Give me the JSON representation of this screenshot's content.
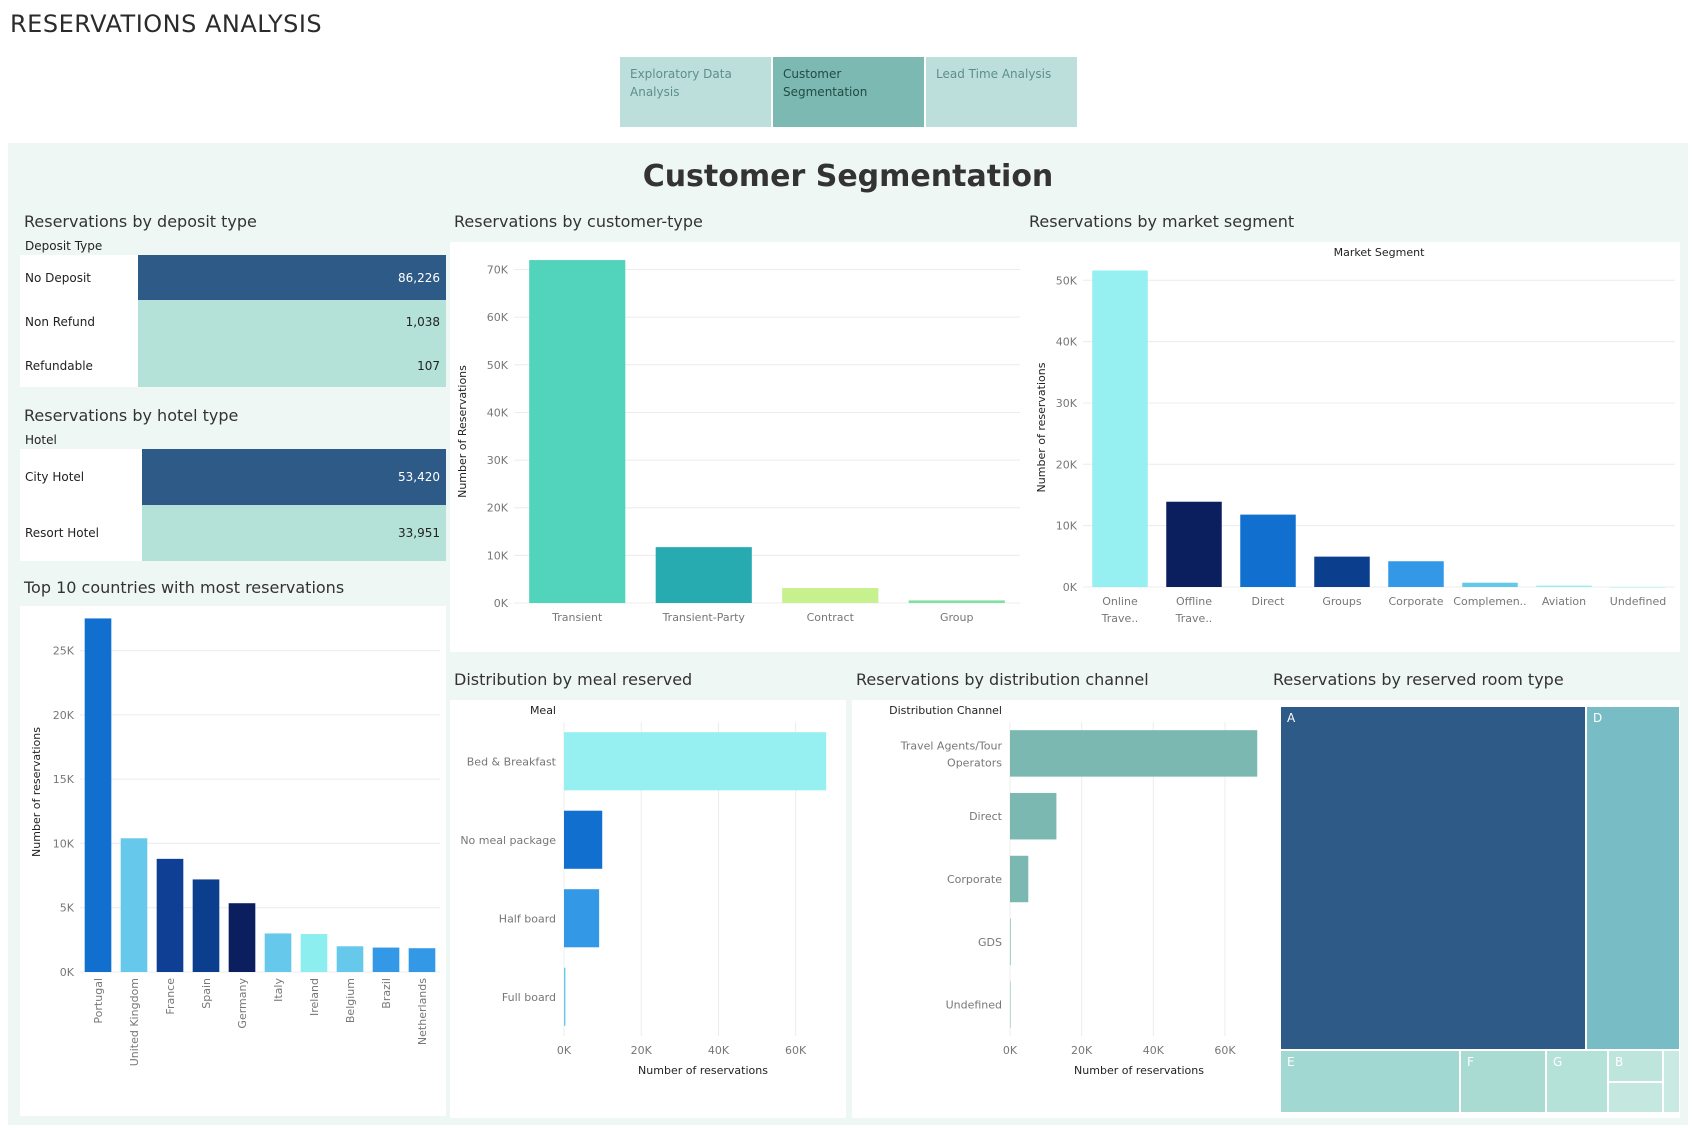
{
  "app": {
    "title": "RESERVATIONS ANALYSIS"
  },
  "tabs": [
    {
      "label": "Exploratory Data Analysis",
      "active": false
    },
    {
      "label": "Customer Segmentation",
      "active": true
    },
    {
      "label": "Lead Time Analysis",
      "active": false
    }
  ],
  "dashboard": {
    "title": "Customer Segmentation"
  },
  "deposit": {
    "title": "Reservations by deposit type",
    "header": "Deposit Type",
    "rows": [
      {
        "label": "No Deposit",
        "value": "86,226"
      },
      {
        "label": "Non Refund",
        "value": "1,038"
      },
      {
        "label": "Refundable",
        "value": "107"
      }
    ],
    "colors": {
      "highlight": "#2e5a87",
      "normal": "#b5e2d8"
    }
  },
  "hotel": {
    "title": "Reservations by hotel type",
    "header": "Hotel",
    "rows": [
      {
        "label": "City Hotel",
        "value": "53,420"
      },
      {
        "label": "Resort Hotel",
        "value": "33,951"
      }
    ]
  },
  "countries": {
    "title": "Top 10 countries with most reservations"
  },
  "customer_type": {
    "title": "Reservations  by customer-type"
  },
  "market": {
    "title": "Reservations by market segment"
  },
  "meal": {
    "title": "Distribution by meal reserved"
  },
  "channel": {
    "title": "Reservations by distribution channel"
  },
  "room": {
    "title": "Reservations by reserved room type",
    "cells": [
      {
        "label": "A",
        "color": "#2e5a87"
      },
      {
        "label": "D",
        "color": "#78bdc5"
      },
      {
        "label": "E",
        "color": "#a2d8d2"
      },
      {
        "label": "F",
        "color": "#a9dbd3"
      },
      {
        "label": "G",
        "color": "#b5e2d8"
      },
      {
        "label": "B",
        "color": "#bde5dc"
      }
    ]
  },
  "chart_data": [
    {
      "type": "bar",
      "id": "countries",
      "title": "Top 10 countries with most reservations",
      "ylabel": "Number of reservations",
      "categories": [
        "Portugal",
        "United Kingdom",
        "France",
        "Spain",
        "Germany",
        "Italy",
        "Ireland",
        "Belgium",
        "Brazil",
        "Netherlands"
      ],
      "values": [
        27500,
        10400,
        8800,
        7200,
        5350,
        3000,
        2950,
        2000,
        1900,
        1850
      ],
      "colors": [
        "#1170cf",
        "#66c9eb",
        "#0f3f94",
        "#0c3e8e",
        "#0b1f5f",
        "#66c9eb",
        "#8ceeee",
        "#66c9eb",
        "#3399e6",
        "#3399e6"
      ],
      "yticks": [
        "0K",
        "5K",
        "10K",
        "15K",
        "20K",
        "25K"
      ],
      "ylim": [
        0,
        28000
      ],
      "grid": true
    },
    {
      "type": "bar",
      "id": "customer_type",
      "title": "Reservations  by customer-type",
      "ylabel": "Number of Reservations",
      "categories": [
        "Transient",
        "Transient-Party",
        "Contract",
        "Group"
      ],
      "values": [
        71986,
        11727,
        3139,
        544
      ],
      "colors": [
        "#52d4bc",
        "#27abb1",
        "#c7f08e",
        "#7fe0a0"
      ],
      "yticks": [
        "0K",
        "10K",
        "20K",
        "30K",
        "40K",
        "50K",
        "60K",
        "70K"
      ],
      "ylim": [
        0,
        72000
      ],
      "grid": true
    },
    {
      "type": "bar",
      "id": "market",
      "title": "Reservations by market segment",
      "subtitle": "Market Segment",
      "ylabel": "Number of reservations",
      "categories": [
        "Online Trave..",
        "Offline Trave..",
        "Direct",
        "Groups",
        "Corporate",
        "Complemen..",
        "Aviation",
        "Undefined"
      ],
      "values": [
        51600,
        13900,
        11800,
        4950,
        4200,
        700,
        230,
        2
      ],
      "colors": [
        "#96eff0",
        "#0b1f5f",
        "#1170cf",
        "#0c3e8e",
        "#3399e6",
        "#66c9eb",
        "#96eff0",
        "#96eff0"
      ],
      "yticks": [
        "0K",
        "10K",
        "20K",
        "30K",
        "40K",
        "50K"
      ],
      "ylim": [
        0,
        52000
      ],
      "grid": true
    },
    {
      "type": "bar",
      "id": "meal",
      "orientation": "horizontal",
      "title": "Distribution by meal reserved",
      "header": "Meal",
      "xlabel": "Number of reservations",
      "categories": [
        "Bed & Breakfast",
        "No meal package",
        "Half board",
        "Full board"
      ],
      "values": [
        67900,
        9900,
        9100,
        360
      ],
      "colors": [
        "#96eff0",
        "#1170cf",
        "#3399e6",
        "#66c9eb"
      ],
      "xticks": [
        "0K",
        "20K",
        "40K",
        "60K"
      ],
      "xlim": [
        0,
        72000
      ],
      "grid": true
    },
    {
      "type": "bar",
      "id": "channel",
      "orientation": "horizontal",
      "title": "Reservations by distribution channel",
      "header": "Distribution Channel",
      "xlabel": "Number of reservations",
      "categories": [
        "Travel Agents/Tour Operators",
        "Direct",
        "Corporate",
        "GDS",
        "Undefined"
      ],
      "values": [
        69000,
        12950,
        5100,
        181,
        5
      ],
      "colors": [
        "#7ab8b1",
        "#7ab8b1",
        "#7ab8b1",
        "#7ab8b1",
        "#7ab8b1"
      ],
      "xticks": [
        "0K",
        "20K",
        "40K",
        "60K"
      ],
      "xlim": [
        0,
        72000
      ],
      "grid": true
    }
  ]
}
